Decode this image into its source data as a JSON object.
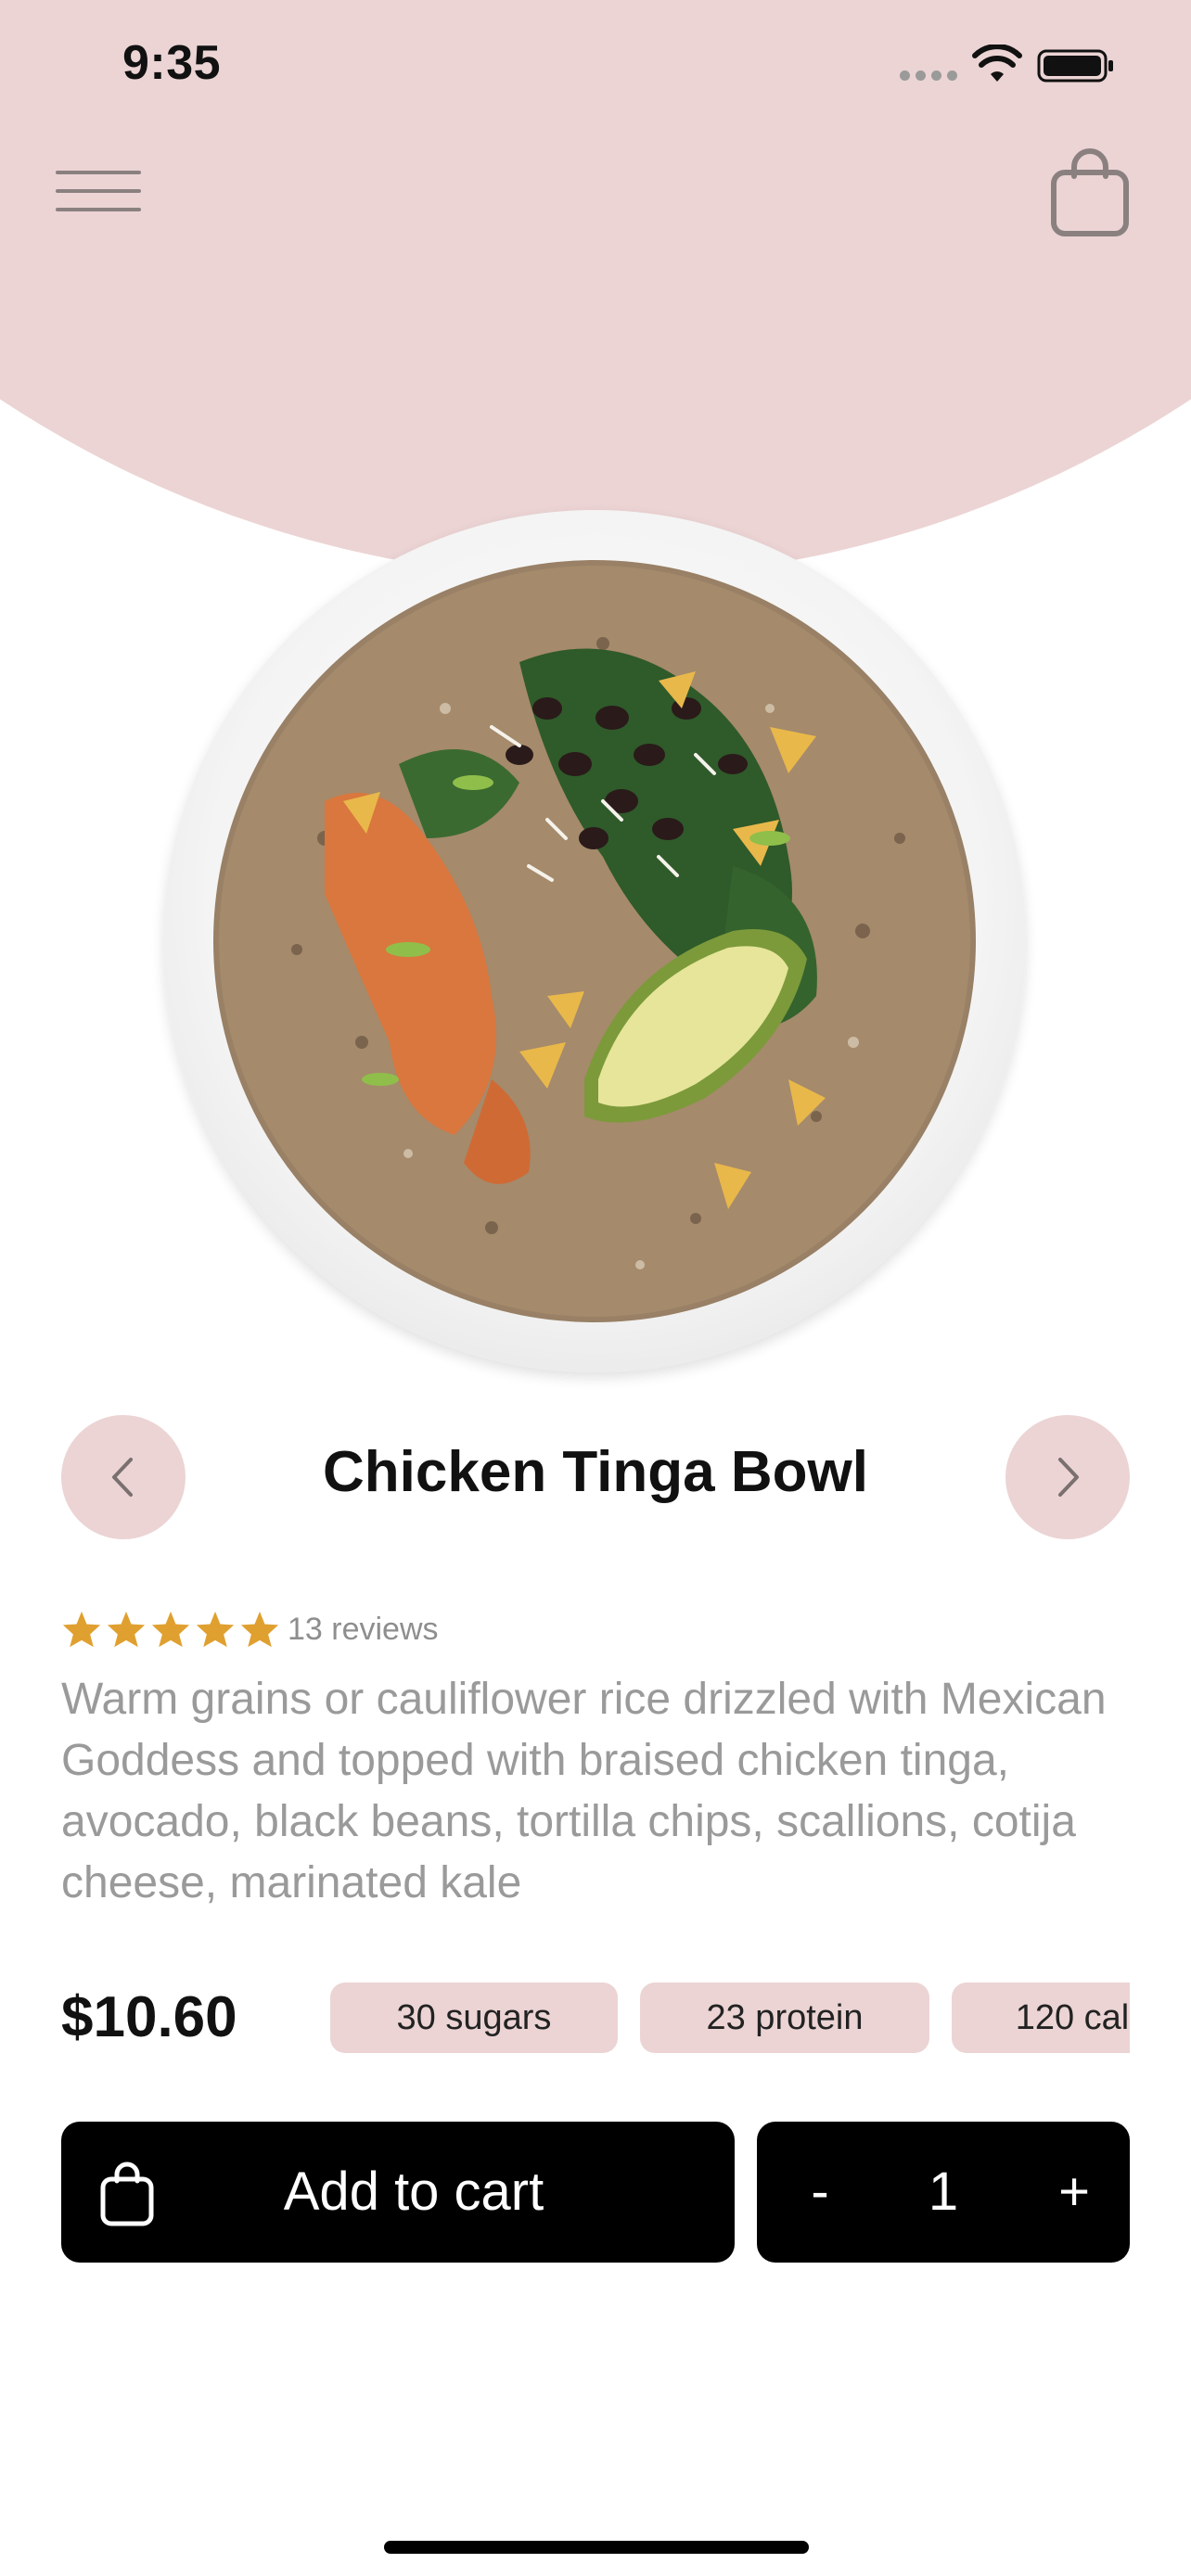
{
  "status_bar": {
    "time": "9:35",
    "icons": [
      "cellular-icon",
      "wifi-icon",
      "battery-icon"
    ]
  },
  "header": {
    "menu_icon": "hamburger-menu-icon",
    "cart_icon": "shopping-bag-icon"
  },
  "product": {
    "image_name": "chicken-tinga-bowl-image",
    "title": "Chicken Tinga Bowl",
    "rating": 5,
    "reviews": "13 reviews",
    "description": "Warm grains or cauliflower rice drizzled with Mexican Goddess and topped with braised chicken tinga, avocado, black beans, tortilla chips, scallions, cotija cheese, marinated kale",
    "price": "$10.60",
    "nutrition": [
      "30 sugars",
      "23 protein",
      "120 cal"
    ]
  },
  "actions": {
    "add_to_cart_label": "Add to cart",
    "quantity": "1",
    "minus": "-",
    "plus": "+"
  },
  "colors": {
    "accent_pink": "#ecd4d4",
    "star": "#e0a030",
    "button_bg": "#000000",
    "text_muted": "#9a9a9a"
  }
}
